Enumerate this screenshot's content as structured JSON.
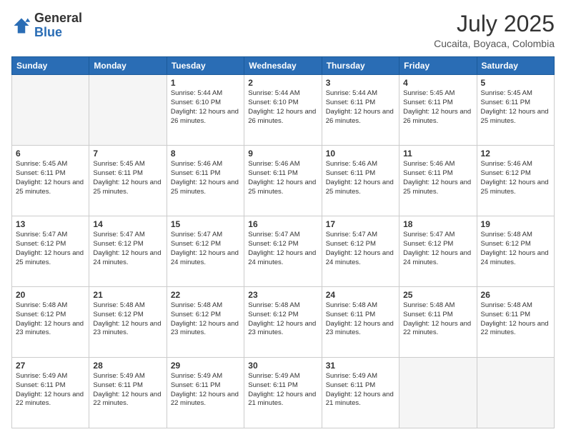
{
  "header": {
    "logo_general": "General",
    "logo_blue": "Blue",
    "month_year": "July 2025",
    "location": "Cucaita, Boyaca, Colombia"
  },
  "days_of_week": [
    "Sunday",
    "Monday",
    "Tuesday",
    "Wednesday",
    "Thursday",
    "Friday",
    "Saturday"
  ],
  "weeks": [
    [
      {
        "day": "",
        "info": ""
      },
      {
        "day": "",
        "info": ""
      },
      {
        "day": "1",
        "info": "Sunrise: 5:44 AM\nSunset: 6:10 PM\nDaylight: 12 hours and 26 minutes."
      },
      {
        "day": "2",
        "info": "Sunrise: 5:44 AM\nSunset: 6:10 PM\nDaylight: 12 hours and 26 minutes."
      },
      {
        "day": "3",
        "info": "Sunrise: 5:44 AM\nSunset: 6:11 PM\nDaylight: 12 hours and 26 minutes."
      },
      {
        "day": "4",
        "info": "Sunrise: 5:45 AM\nSunset: 6:11 PM\nDaylight: 12 hours and 26 minutes."
      },
      {
        "day": "5",
        "info": "Sunrise: 5:45 AM\nSunset: 6:11 PM\nDaylight: 12 hours and 25 minutes."
      }
    ],
    [
      {
        "day": "6",
        "info": "Sunrise: 5:45 AM\nSunset: 6:11 PM\nDaylight: 12 hours and 25 minutes."
      },
      {
        "day": "7",
        "info": "Sunrise: 5:45 AM\nSunset: 6:11 PM\nDaylight: 12 hours and 25 minutes."
      },
      {
        "day": "8",
        "info": "Sunrise: 5:46 AM\nSunset: 6:11 PM\nDaylight: 12 hours and 25 minutes."
      },
      {
        "day": "9",
        "info": "Sunrise: 5:46 AM\nSunset: 6:11 PM\nDaylight: 12 hours and 25 minutes."
      },
      {
        "day": "10",
        "info": "Sunrise: 5:46 AM\nSunset: 6:11 PM\nDaylight: 12 hours and 25 minutes."
      },
      {
        "day": "11",
        "info": "Sunrise: 5:46 AM\nSunset: 6:11 PM\nDaylight: 12 hours and 25 minutes."
      },
      {
        "day": "12",
        "info": "Sunrise: 5:46 AM\nSunset: 6:12 PM\nDaylight: 12 hours and 25 minutes."
      }
    ],
    [
      {
        "day": "13",
        "info": "Sunrise: 5:47 AM\nSunset: 6:12 PM\nDaylight: 12 hours and 25 minutes."
      },
      {
        "day": "14",
        "info": "Sunrise: 5:47 AM\nSunset: 6:12 PM\nDaylight: 12 hours and 24 minutes."
      },
      {
        "day": "15",
        "info": "Sunrise: 5:47 AM\nSunset: 6:12 PM\nDaylight: 12 hours and 24 minutes."
      },
      {
        "day": "16",
        "info": "Sunrise: 5:47 AM\nSunset: 6:12 PM\nDaylight: 12 hours and 24 minutes."
      },
      {
        "day": "17",
        "info": "Sunrise: 5:47 AM\nSunset: 6:12 PM\nDaylight: 12 hours and 24 minutes."
      },
      {
        "day": "18",
        "info": "Sunrise: 5:47 AM\nSunset: 6:12 PM\nDaylight: 12 hours and 24 minutes."
      },
      {
        "day": "19",
        "info": "Sunrise: 5:48 AM\nSunset: 6:12 PM\nDaylight: 12 hours and 24 minutes."
      }
    ],
    [
      {
        "day": "20",
        "info": "Sunrise: 5:48 AM\nSunset: 6:12 PM\nDaylight: 12 hours and 23 minutes."
      },
      {
        "day": "21",
        "info": "Sunrise: 5:48 AM\nSunset: 6:12 PM\nDaylight: 12 hours and 23 minutes."
      },
      {
        "day": "22",
        "info": "Sunrise: 5:48 AM\nSunset: 6:12 PM\nDaylight: 12 hours and 23 minutes."
      },
      {
        "day": "23",
        "info": "Sunrise: 5:48 AM\nSunset: 6:12 PM\nDaylight: 12 hours and 23 minutes."
      },
      {
        "day": "24",
        "info": "Sunrise: 5:48 AM\nSunset: 6:11 PM\nDaylight: 12 hours and 23 minutes."
      },
      {
        "day": "25",
        "info": "Sunrise: 5:48 AM\nSunset: 6:11 PM\nDaylight: 12 hours and 22 minutes."
      },
      {
        "day": "26",
        "info": "Sunrise: 5:48 AM\nSunset: 6:11 PM\nDaylight: 12 hours and 22 minutes."
      }
    ],
    [
      {
        "day": "27",
        "info": "Sunrise: 5:49 AM\nSunset: 6:11 PM\nDaylight: 12 hours and 22 minutes."
      },
      {
        "day": "28",
        "info": "Sunrise: 5:49 AM\nSunset: 6:11 PM\nDaylight: 12 hours and 22 minutes."
      },
      {
        "day": "29",
        "info": "Sunrise: 5:49 AM\nSunset: 6:11 PM\nDaylight: 12 hours and 22 minutes."
      },
      {
        "day": "30",
        "info": "Sunrise: 5:49 AM\nSunset: 6:11 PM\nDaylight: 12 hours and 21 minutes."
      },
      {
        "day": "31",
        "info": "Sunrise: 5:49 AM\nSunset: 6:11 PM\nDaylight: 12 hours and 21 minutes."
      },
      {
        "day": "",
        "info": ""
      },
      {
        "day": "",
        "info": ""
      }
    ]
  ]
}
